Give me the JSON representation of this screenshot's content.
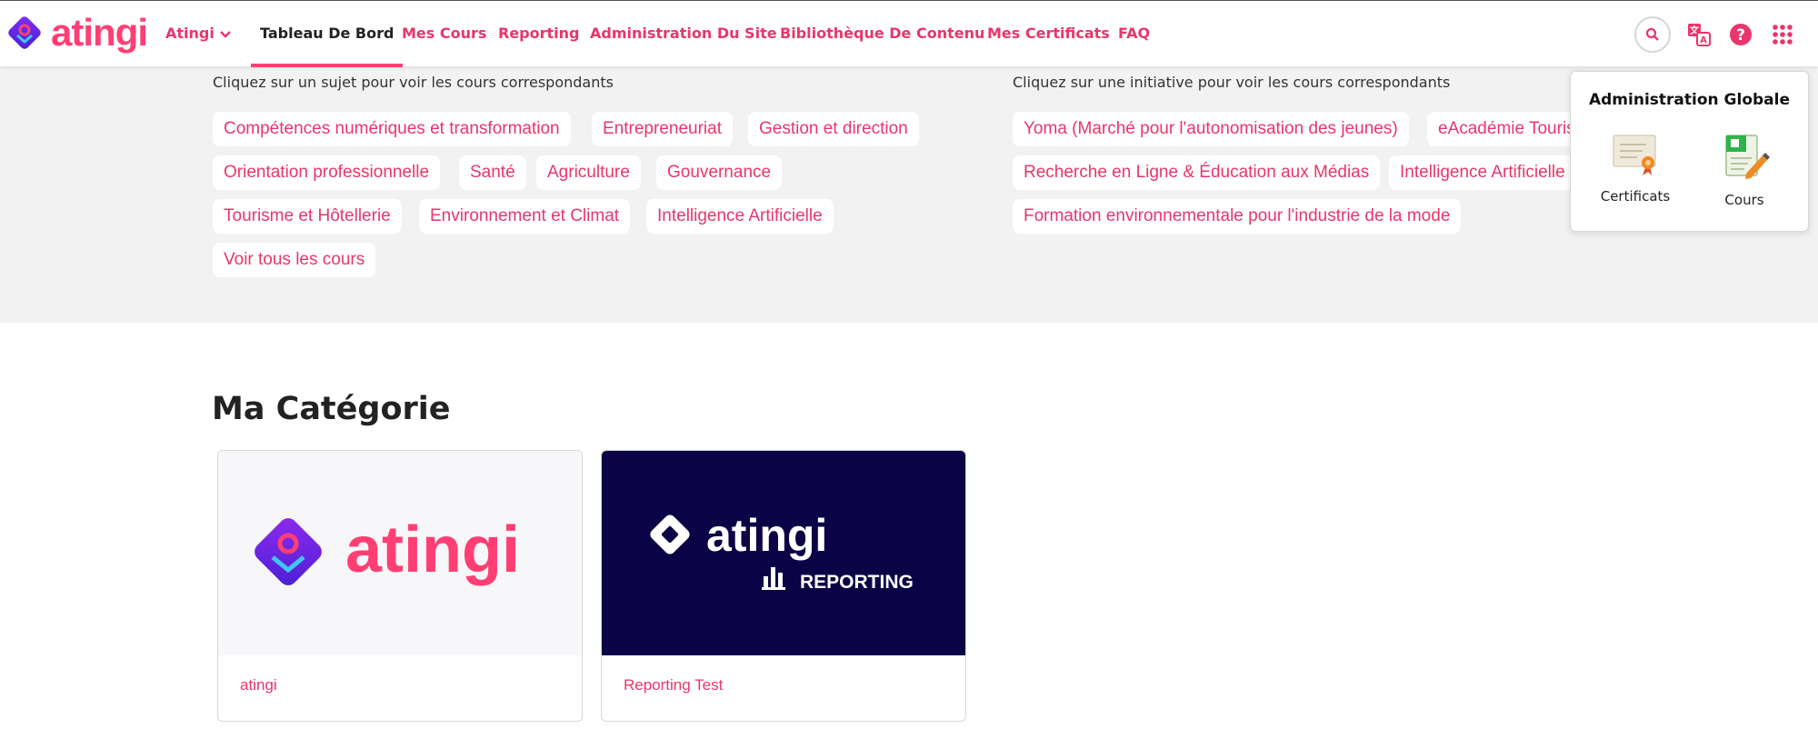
{
  "app": {
    "logo_text": "atingi",
    "brand_color": "#ff3f73",
    "link_color": "#e8366c"
  },
  "nav": {
    "org_label": "Atingi",
    "items": [
      {
        "label": "Tableau De Bord",
        "active": true
      },
      {
        "label": "Mes Cours"
      },
      {
        "label": "Reporting"
      },
      {
        "label": "Administration Du Site"
      },
      {
        "label": "Bibliothèque De Contenu"
      },
      {
        "label": "Mes Certificats"
      },
      {
        "label": "FAQ"
      }
    ],
    "icons": [
      "search-icon",
      "translate-icon",
      "help-icon",
      "apps-grid-icon"
    ]
  },
  "subjects": {
    "hint": "Cliquez sur un sujet pour voir les cours correspondants",
    "chips": [
      "Compétences numériques et transformation",
      "Entrepreneuriat",
      "Gestion et direction",
      "Orientation professionnelle",
      "Santé",
      "Agriculture",
      "Gouvernance",
      "Tourisme et Hôtellerie",
      "Environnement et Climat",
      "Intelligence Artificielle",
      "Voir tous les cours"
    ]
  },
  "initiatives": {
    "hint": "Cliquez sur une initiative pour voir les cours correspondants",
    "chips": [
      "Yoma (Marché pour l'autonomisation des jeunes)",
      "eAcadémie Tourisme",
      "Recherche en Ligne & Éducation aux Médias",
      "Intelligence Artificielle",
      "Formation environnementale pour l'industrie de la mode"
    ]
  },
  "popover": {
    "title": "Administration Globale",
    "items": [
      {
        "label": "Certificats",
        "icon": "certificate-icon"
      },
      {
        "label": "Cours",
        "icon": "course-edit-icon"
      }
    ]
  },
  "category": {
    "title": "Ma Catégorie",
    "cards": [
      {
        "label": "atingi",
        "image_text": "atingi",
        "background": "#f7f7f9"
      },
      {
        "label": "Reporting Test",
        "image_text": "atingi",
        "image_subtext": "REPORTING",
        "background": "#0b0345"
      }
    ]
  }
}
